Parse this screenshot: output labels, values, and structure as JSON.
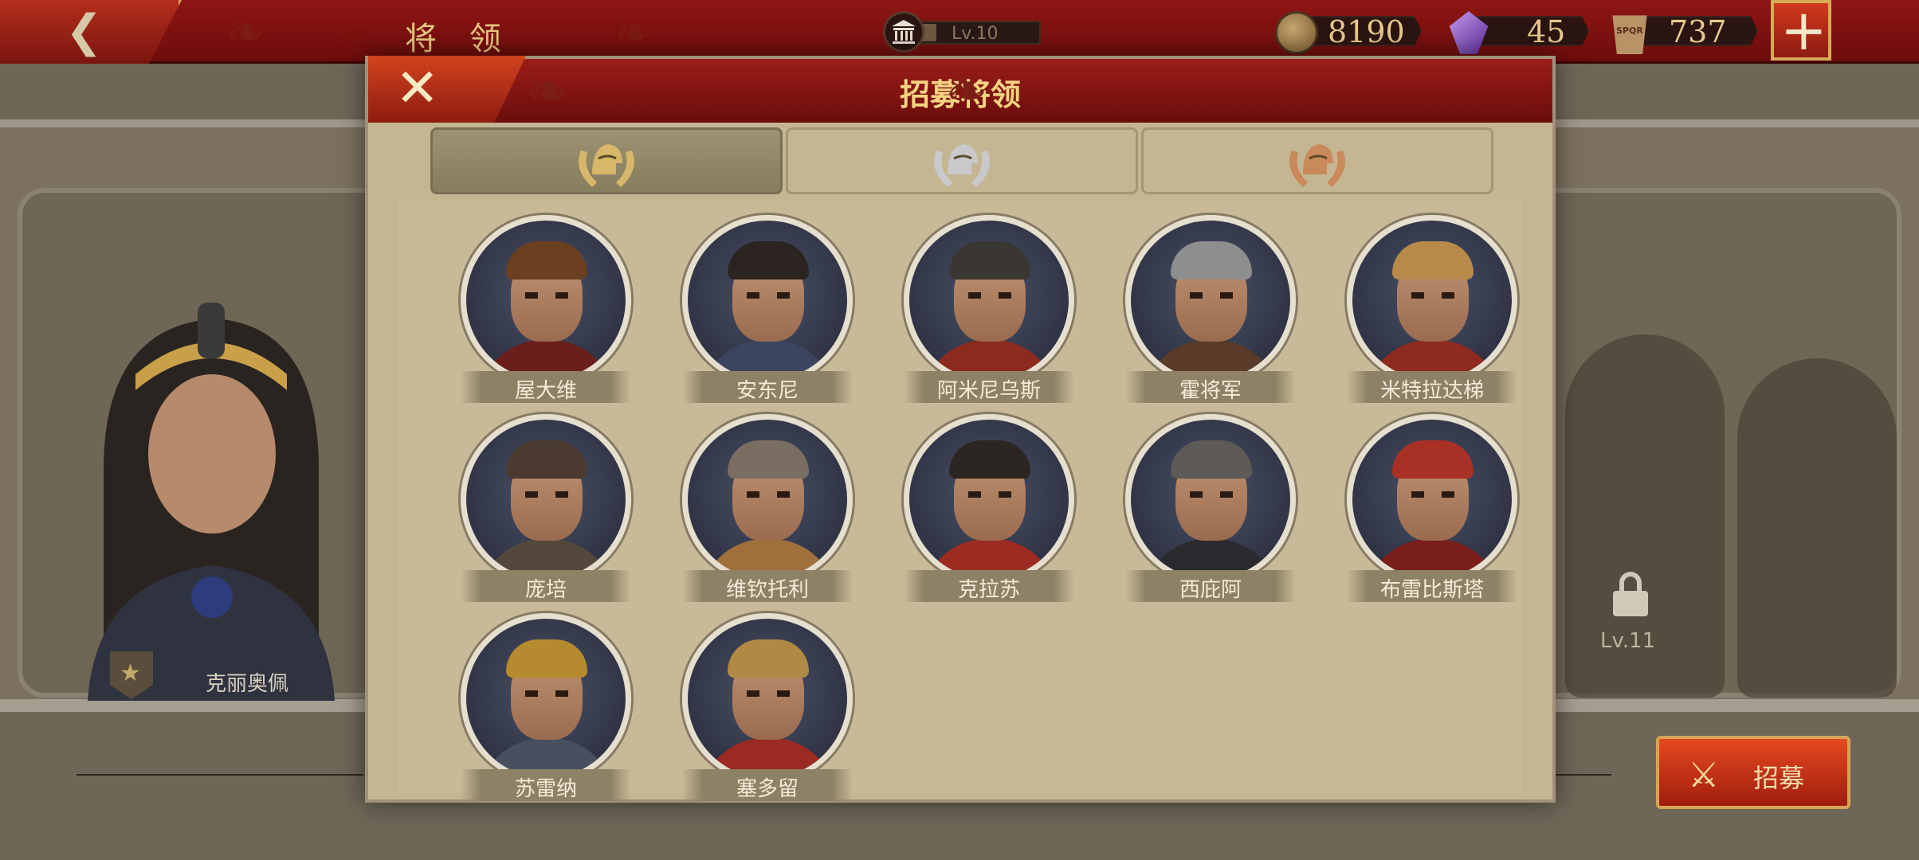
{
  "topbar": {
    "page_title": "将 领",
    "level_label": "Lv.10",
    "level_progress": 0.15,
    "resources": [
      {
        "icon": "coin-icon",
        "value": "8190"
      },
      {
        "icon": "gem-icon",
        "value": "45"
      },
      {
        "icon": "spqr-icon",
        "value": "737"
      }
    ],
    "spqr_text": "SPQR"
  },
  "background": {
    "general_name": "克丽奥佩",
    "locked_level": "Lv.11",
    "recruit_label": "招募"
  },
  "modal": {
    "title": "招募将领",
    "tabs": [
      {
        "tier": "gold",
        "color": "#d7b86a",
        "active": true
      },
      {
        "tier": "silver",
        "color": "#c9c9cc",
        "active": false
      },
      {
        "tier": "bronze",
        "color": "#c9895a",
        "active": false
      }
    ],
    "generals": [
      {
        "name": "屋大维",
        "hair": "#6a3f22",
        "body": "#6b1f1c"
      },
      {
        "name": "安东尼",
        "hair": "#2b2420",
        "body": "#3c4560"
      },
      {
        "name": "阿米尼乌斯",
        "hair": "#3a3733",
        "body": "#8c2a1e"
      },
      {
        "name": "霍将军",
        "hair": "#8e8e8e",
        "body": "#5a3b2a"
      },
      {
        "name": "米特拉达梯",
        "hair": "#b78a4c",
        "body": "#8e2a20"
      },
      {
        "name": "庞培",
        "hair": "#4a3a30",
        "body": "#54483c"
      },
      {
        "name": "维钦托利",
        "hair": "#7a6e62",
        "body": "#a0703c"
      },
      {
        "name": "克拉苏",
        "hair": "#2c2622",
        "body": "#9c2b22"
      },
      {
        "name": "西庇阿",
        "hair": "#5e5a58",
        "body": "#2a2a2e"
      },
      {
        "name": "布雷比斯塔",
        "hair": "#a83024",
        "body": "#7a1e1c"
      },
      {
        "name": "苏雷纳",
        "hair": "#b68a2e",
        "body": "#46505e"
      },
      {
        "name": "塞多留",
        "hair": "#b08a44",
        "body": "#9a2a22"
      }
    ]
  }
}
